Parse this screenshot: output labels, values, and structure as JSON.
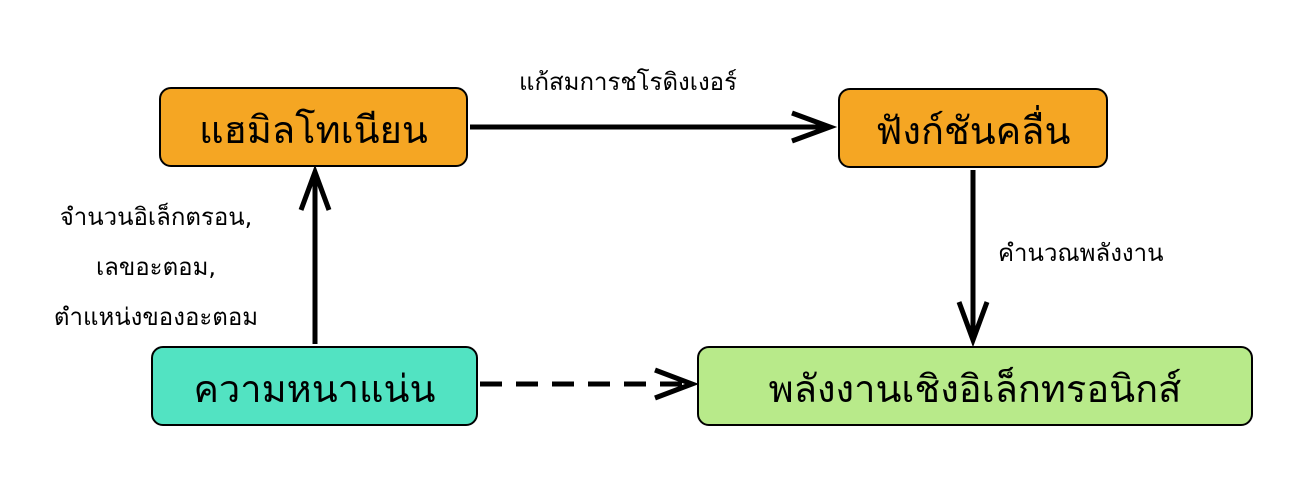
{
  "colors": {
    "hamiltonian_fill": "#F5A623",
    "wavefunction_fill": "#F5A623",
    "density_fill": "#52E3C2",
    "energy_fill": "#B8EA8A",
    "stroke": "#000000"
  },
  "nodes": {
    "hamiltonian": "แฮมิลโทเนียน",
    "wavefunction": "ฟังก์ชันคลื่น",
    "density": "ความหนาแน่น",
    "energy": "พลังงานเชิงอิเล็กทรอนิกส์"
  },
  "edges": {
    "schrodinger": "แก้สมการชโรดิงเงอร์",
    "calc_energy": "คำนวณพลังงาน",
    "inputs": {
      "line1": "จำนวนอิเล็กตรอน,",
      "line2": "เลขอะตอม,",
      "line3": "ตำแหน่งของอะตอม"
    }
  }
}
